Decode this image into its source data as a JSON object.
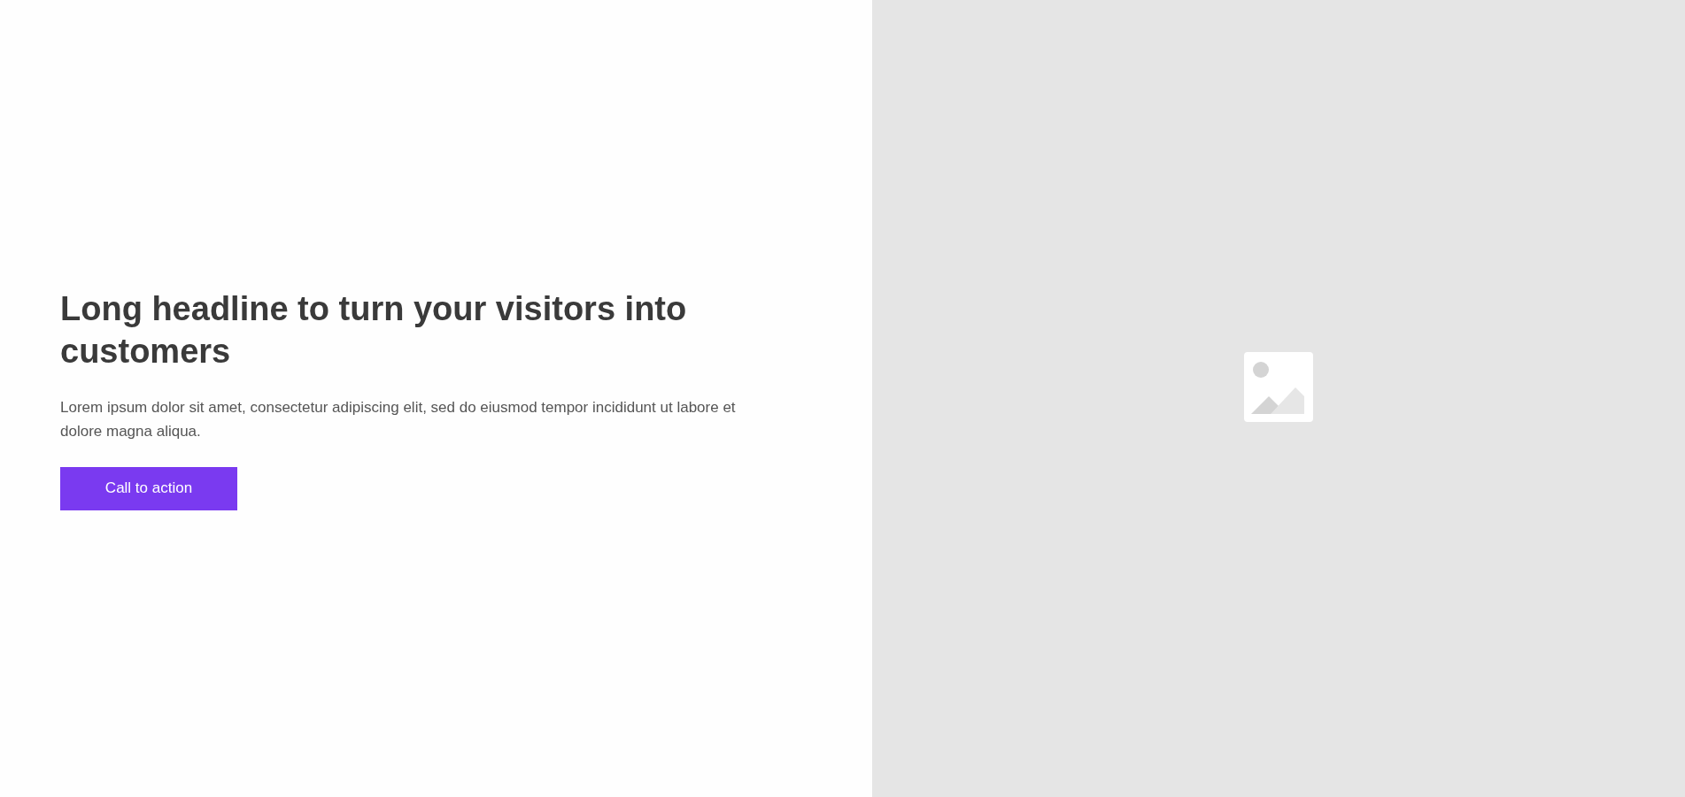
{
  "hero": {
    "headline": "Long headline to turn your visitors into customers",
    "body": "Lorem ipsum dolor sit amet, consectetur adipiscing elit, sed do eiusmod tempor incididunt ut labore et dolore magna aliqua.",
    "button": "Call to action"
  },
  "media": {
    "kind": "image-placeholder"
  }
}
